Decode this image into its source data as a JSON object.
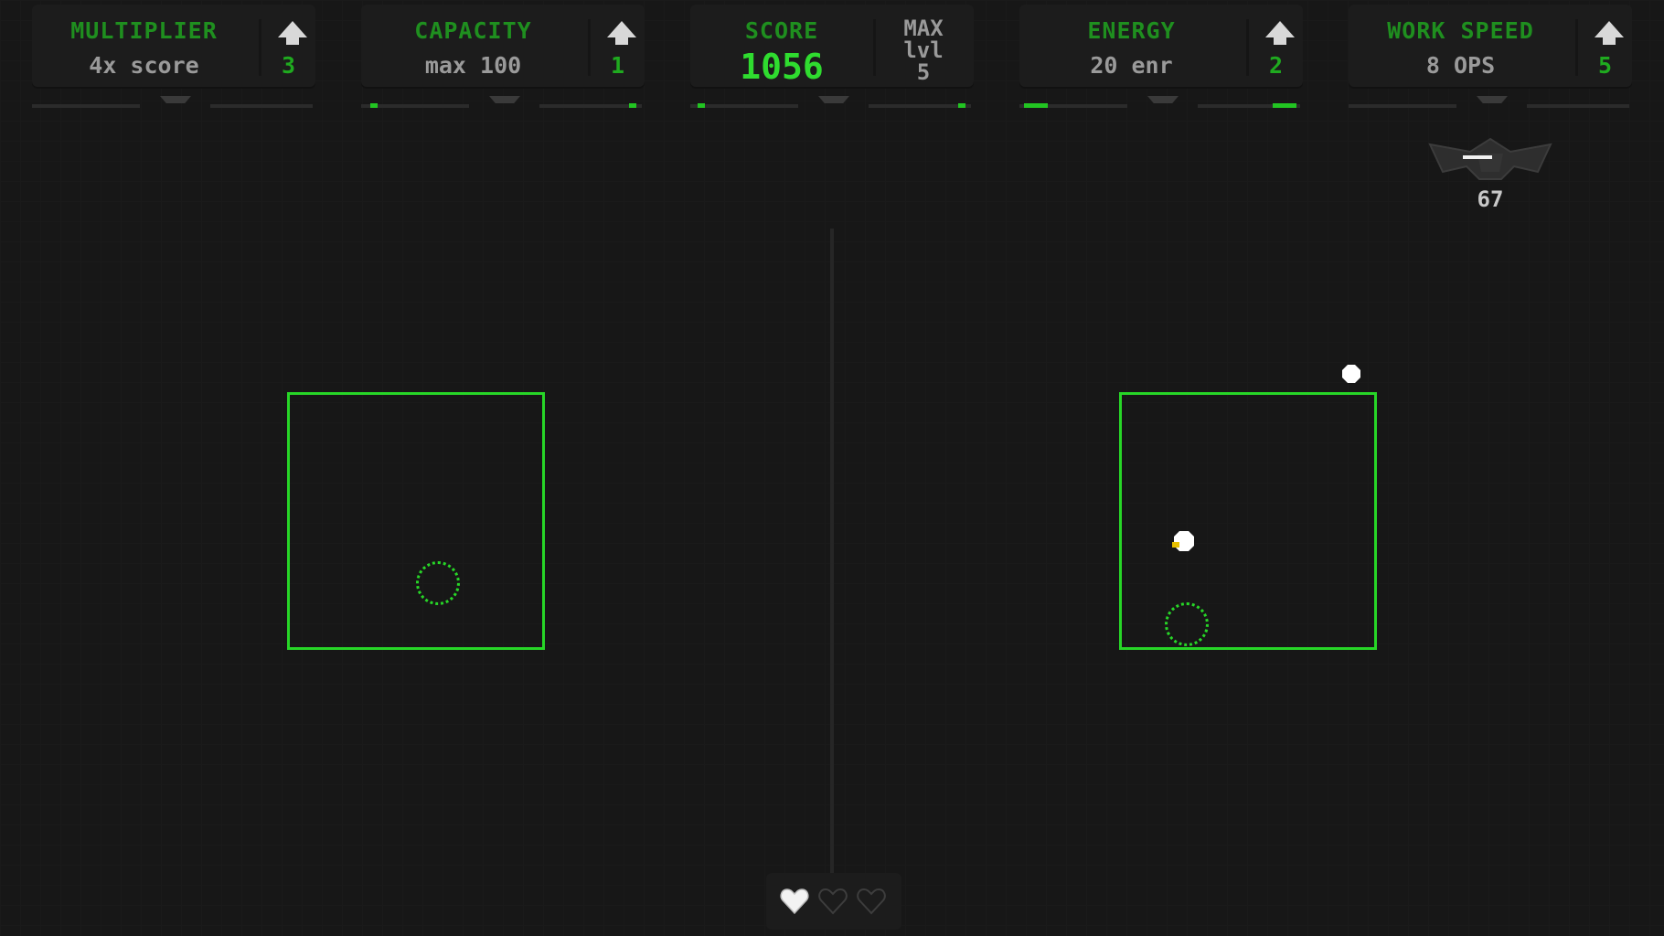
{
  "upgrades": {
    "multiplier": {
      "title": "MULTIPLIER",
      "desc": "4x score",
      "level": "3",
      "icon": "arrow-up-icon"
    },
    "capacity": {
      "title": "CAPACITY",
      "desc": "max 100",
      "level": "1",
      "icon": "arrow-up-icon"
    },
    "energy": {
      "title": "ENERGY",
      "desc": "20 enr",
      "level": "2",
      "icon": "arrow-up-icon"
    },
    "work_speed": {
      "title": "WORK SPEED",
      "desc": "8 OPS",
      "level": "5",
      "icon": "arrow-up-icon"
    }
  },
  "score": {
    "title": "SCORE",
    "value": "1056",
    "max_line1": "MAX",
    "max_line2": "lvl",
    "max_line3": "5"
  },
  "enemy_badge": {
    "icon": "ship-emblem-icon",
    "count": "67"
  },
  "lives": {
    "total": 3,
    "filled": 1,
    "icon": "heart-icon"
  },
  "colors": {
    "accent_green": "#27d627",
    "bright_green": "#2fdc2f",
    "dim_green": "#1f8f1f",
    "background": "#171717"
  }
}
